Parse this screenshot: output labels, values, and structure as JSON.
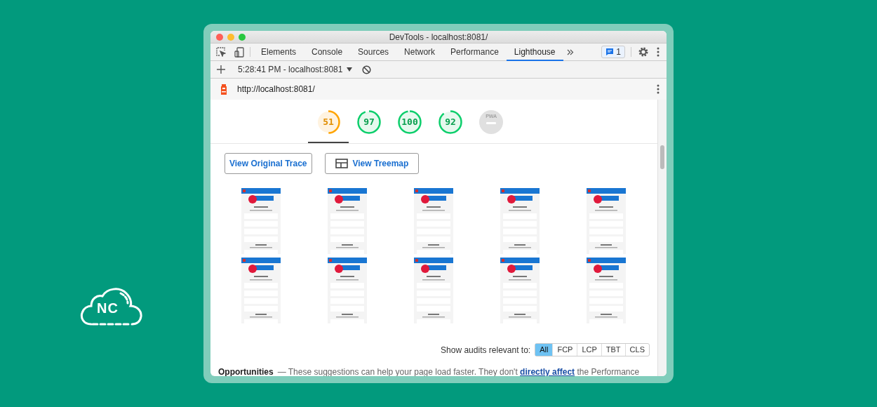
{
  "window": {
    "title": "DevTools - localhost:8081/"
  },
  "tabs": [
    {
      "label": "Elements",
      "selected": false
    },
    {
      "label": "Console",
      "selected": false
    },
    {
      "label": "Sources",
      "selected": false
    },
    {
      "label": "Network",
      "selected": false
    },
    {
      "label": "Performance",
      "selected": false
    },
    {
      "label": "Lighthouse",
      "selected": true
    }
  ],
  "issues_badge": "1",
  "toolbar": {
    "report": "5:28:41 PM - localhost:8081"
  },
  "url_bar": {
    "url": "http://localhost:8081/"
  },
  "gauges": [
    {
      "kind": "score",
      "score": "51",
      "level": 0.51,
      "selected": true
    },
    {
      "kind": "score",
      "score": "97",
      "level": 0.97,
      "selected": false
    },
    {
      "kind": "score",
      "score": "100",
      "level": 1,
      "selected": false
    },
    {
      "kind": "score",
      "score": "92",
      "level": 0.92,
      "selected": false
    },
    {
      "kind": "pwa",
      "label": "PWA",
      "selected": false
    }
  ],
  "buttons": [
    {
      "kind": "plain",
      "label": "View Original Trace"
    },
    {
      "kind": "treemap",
      "label": "View Treemap"
    }
  ],
  "audit_filter": {
    "label": "Show audits relevant to:",
    "options": [
      {
        "label": "All",
        "selected": true
      },
      {
        "label": "FCP",
        "selected": false
      },
      {
        "label": "LCP",
        "selected": false
      },
      {
        "label": "TBT",
        "selected": false
      },
      {
        "label": "CLS",
        "selected": false
      }
    ]
  },
  "opportunities": {
    "title": "Opportunities",
    "text_before": "— These suggestions can help your page load faster. They don't",
    "link": "directly affect",
    "text_after": "the Performance"
  },
  "logo": {
    "text": "NC"
  }
}
